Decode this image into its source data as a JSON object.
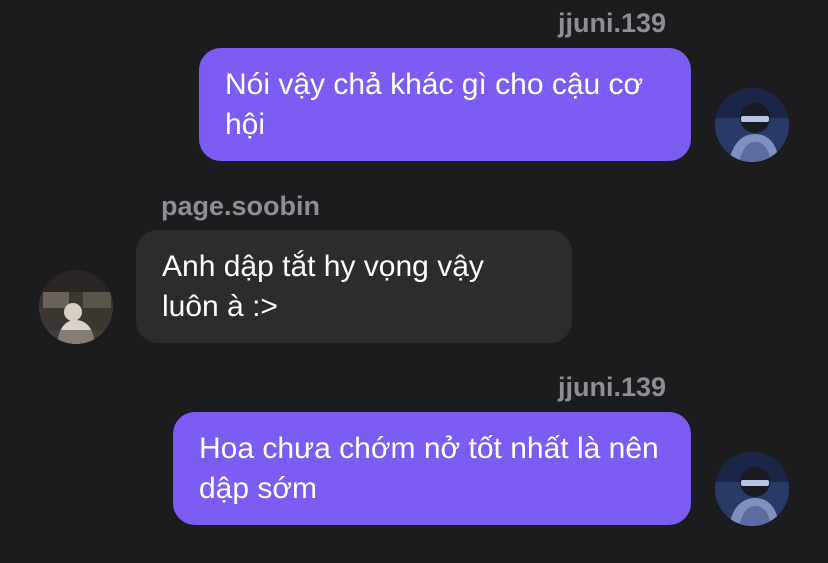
{
  "messages": [
    {
      "sender": "jjuni.139",
      "text": "Nói vậy chả khác gì cho cậu cơ hội",
      "direction": "outgoing",
      "avatar_icon": "user-avatar-icon"
    },
    {
      "sender": "page.soobin",
      "text": "Anh dập tắt hy vọng vậy luôn à :>",
      "direction": "incoming",
      "avatar_icon": "contact-avatar-icon"
    },
    {
      "sender": "jjuni.139",
      "text": "Hoa chưa chớm nở tốt nhất là nên dập sớm",
      "direction": "outgoing",
      "avatar_icon": "user-avatar-icon"
    }
  ],
  "colors": {
    "background": "#1c1c1e",
    "outgoing_bubble": "#7d5cf4",
    "incoming_bubble": "#2c2c2e",
    "sender_name": "#8e8e93",
    "message_text": "#ffffff"
  }
}
